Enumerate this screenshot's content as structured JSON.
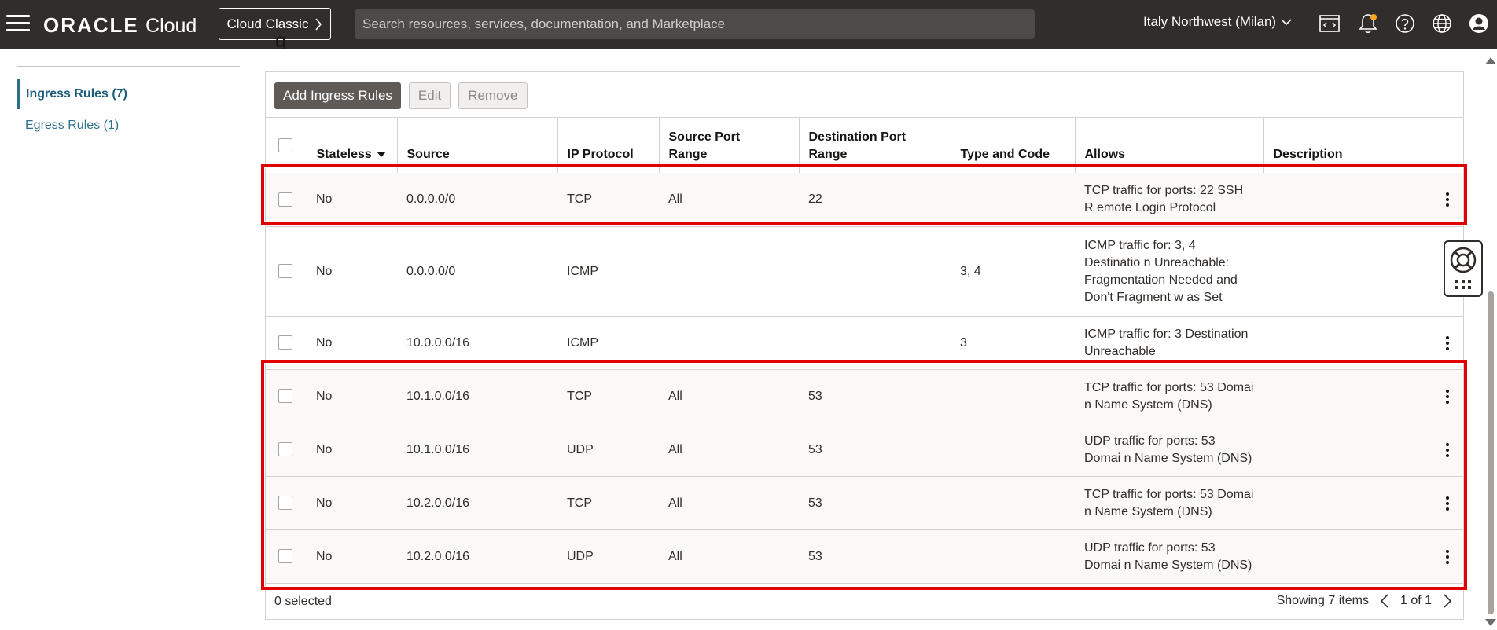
{
  "header": {
    "brand": "ORACLE",
    "brand_suffix": "Cloud",
    "classic_button": "Cloud Classic",
    "search_placeholder": "Search resources, services, documentation, and Marketplace",
    "region": "Italy Northwest (Milan)",
    "icons": [
      "code-editor-icon",
      "bell-icon",
      "help-icon",
      "globe-icon",
      "user-icon"
    ]
  },
  "page": {
    "title_fragment": "g"
  },
  "sidebar": {
    "items": [
      {
        "label": "Ingress Rules (7)",
        "active": true
      },
      {
        "label": "Egress Rules (1)",
        "active": false
      }
    ]
  },
  "toolbar": {
    "add_label": "Add Ingress Rules",
    "edit_label": "Edit",
    "remove_label": "Remove"
  },
  "table": {
    "columns": [
      "Stateless",
      "Source",
      "IP Protocol",
      "Source Port Range",
      "Destination Port Range",
      "Type and Code",
      "Allows",
      "Description"
    ],
    "column_lines": {
      "source_port": [
        "Source Port",
        "Range"
      ],
      "dest_port": [
        "Destination Port",
        "Range"
      ]
    },
    "rows": [
      {
        "stateless": "No",
        "source": "0.0.0.0/0",
        "protocol": "TCP",
        "src_port": "All",
        "dst_port": "22",
        "type_code": "",
        "allows": "TCP traffic for ports: 22 SSH R emote Login Protocol",
        "description": ""
      },
      {
        "stateless": "No",
        "source": "0.0.0.0/0",
        "protocol": "ICMP",
        "src_port": "",
        "dst_port": "",
        "type_code": "3, 4",
        "allows": "ICMP traffic for: 3, 4 Destinatio n Unreachable: Fragmentation Needed and Don't Fragment w as Set",
        "description": ""
      },
      {
        "stateless": "No",
        "source": "10.0.0.0/16",
        "protocol": "ICMP",
        "src_port": "",
        "dst_port": "",
        "type_code": "3",
        "allows": "ICMP traffic for: 3 Destination Unreachable",
        "description": ""
      },
      {
        "stateless": "No",
        "source": "10.1.0.0/16",
        "protocol": "TCP",
        "src_port": "All",
        "dst_port": "53",
        "type_code": "",
        "allows": "TCP traffic for ports: 53 Domai n Name System (DNS)",
        "description": ""
      },
      {
        "stateless": "No",
        "source": "10.1.0.0/16",
        "protocol": "UDP",
        "src_port": "All",
        "dst_port": "53",
        "type_code": "",
        "allows": "UDP traffic for ports: 53 Domai n Name System (DNS)",
        "description": ""
      },
      {
        "stateless": "No",
        "source": "10.2.0.0/16",
        "protocol": "TCP",
        "src_port": "All",
        "dst_port": "53",
        "type_code": "",
        "allows": "TCP traffic for ports: 53 Domai n Name System (DNS)",
        "description": ""
      },
      {
        "stateless": "No",
        "source": "10.2.0.0/16",
        "protocol": "UDP",
        "src_port": "All",
        "dst_port": "53",
        "type_code": "",
        "allows": "UDP traffic for ports: 53 Domai n Name System (DNS)",
        "description": ""
      }
    ]
  },
  "footer": {
    "selected": "0 selected",
    "showing": "Showing 7 items",
    "pagination": "1 of 1"
  },
  "colors": {
    "header_bg": "#312d2a",
    "link": "#2f6f89",
    "highlight": "#e00000",
    "primary_button": "#5f5a56"
  }
}
